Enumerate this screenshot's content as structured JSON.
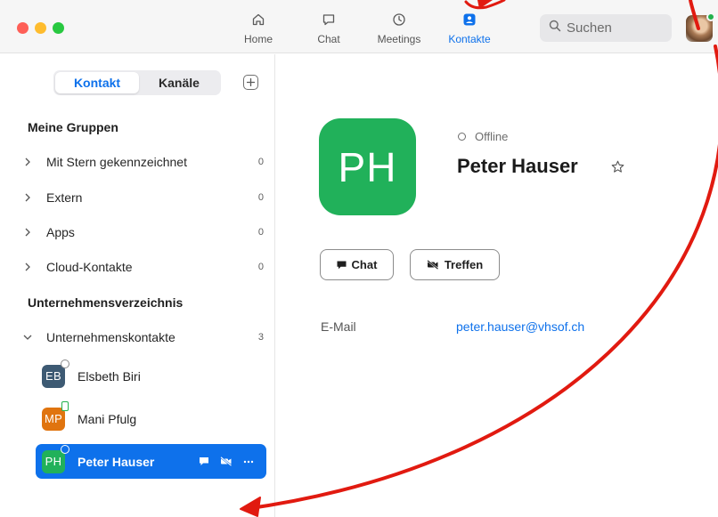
{
  "nav": {
    "tabs": [
      {
        "label": "Home",
        "icon": "home-icon"
      },
      {
        "label": "Chat",
        "icon": "chat-bubble-icon"
      },
      {
        "label": "Meetings",
        "icon": "clock-icon"
      },
      {
        "label": "Kontakte",
        "icon": "contact-card-icon",
        "active": true
      }
    ],
    "search_placeholder": "Suchen",
    "accent_color": "#0e71eb"
  },
  "sidebar": {
    "segment": {
      "active": "Kontakt",
      "other": "Kanäle"
    },
    "my_groups_title": "Meine Gruppen",
    "groups": [
      {
        "name": "Mit Stern gekennzeichnet",
        "count": "0"
      },
      {
        "name": "Extern",
        "count": "0"
      },
      {
        "name": "Apps",
        "count": "0"
      },
      {
        "name": "Cloud-Kontakte",
        "count": "0"
      }
    ],
    "directory_title": "Unternehmensverzeichnis",
    "directory_group": {
      "name": "Unternehmenskontakte",
      "count": "3"
    },
    "contacts": [
      {
        "initials": "EB",
        "name": "Elsbeth Biri",
        "color": "#3d5a73",
        "status": "offline"
      },
      {
        "initials": "MP",
        "name": "Mani Pfulg",
        "color": "#e0740f",
        "status": "mobile"
      },
      {
        "initials": "PH",
        "name": "Peter Hauser",
        "color": "#21b15a",
        "status": "offline",
        "selected": true
      }
    ]
  },
  "profile": {
    "initials": "PH",
    "status": "Offline",
    "name": "Peter Hauser",
    "chat_button": "Chat",
    "meet_button": "Treffen",
    "email_label": "E-Mail",
    "email_value": "peter.hauser@vhsof.ch",
    "avatar_color": "#21b15a"
  }
}
